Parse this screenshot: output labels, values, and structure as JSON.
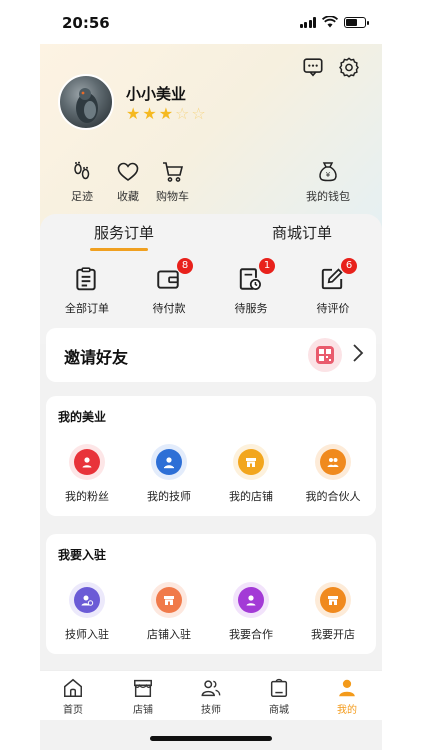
{
  "status": {
    "time": "20:56"
  },
  "colors": {
    "accent": "#f39a1a",
    "badge": "#e8211b",
    "star": "#f5b921"
  },
  "profile": {
    "name": "小小美业",
    "rating": 3,
    "rating_max": 5
  },
  "header_icons": [
    "message-icon",
    "gear-icon"
  ],
  "quick_links": [
    {
      "label": "足迹",
      "icon": "footprint-icon"
    },
    {
      "label": "收藏",
      "icon": "heart-icon"
    },
    {
      "label": "购物车",
      "icon": "cart-icon"
    },
    {
      "label": "我的钱包",
      "icon": "wallet-icon"
    }
  ],
  "order_tabs": [
    {
      "label": "服务订单",
      "active": true
    },
    {
      "label": "商城订单",
      "active": false
    }
  ],
  "orders": [
    {
      "label": "全部订单",
      "icon": "clipboard-icon",
      "badge": ""
    },
    {
      "label": "待付款",
      "icon": "wallet-card-icon",
      "badge": "8"
    },
    {
      "label": "待服务",
      "icon": "clock-doc-icon",
      "badge": "1"
    },
    {
      "label": "待评价",
      "icon": "edit-icon",
      "badge": "6"
    }
  ],
  "invite": {
    "title": "邀请好友"
  },
  "my_beauty": {
    "title": "我的美业",
    "items": [
      {
        "label": "我的粉丝",
        "color": "#e8333a",
        "bg": "#fde6e7"
      },
      {
        "label": "我的技师",
        "color": "#2d6fd6",
        "bg": "#e3ecfb"
      },
      {
        "label": "我的店铺",
        "color": "#f2a61e",
        "bg": "#fdf1dc"
      },
      {
        "label": "我的合伙人",
        "color": "#f08a1e",
        "bg": "#fdebd8"
      }
    ]
  },
  "join": {
    "title": "我要入驻",
    "items": [
      {
        "label": "技师入驻",
        "color": "#6b5bd6",
        "bg": "#ece9fb"
      },
      {
        "label": "店铺入驻",
        "color": "#f07a4a",
        "bg": "#fde8df"
      },
      {
        "label": "我要合作",
        "color": "#a33ad6",
        "bg": "#f2e3fb"
      },
      {
        "label": "我要开店",
        "color": "#f08a1e",
        "bg": "#fdebd8"
      }
    ]
  },
  "tabbar": [
    {
      "label": "首页",
      "active": false
    },
    {
      "label": "店铺",
      "active": false
    },
    {
      "label": "技师",
      "active": false
    },
    {
      "label": "商城",
      "active": false
    },
    {
      "label": "我的",
      "active": true
    }
  ]
}
